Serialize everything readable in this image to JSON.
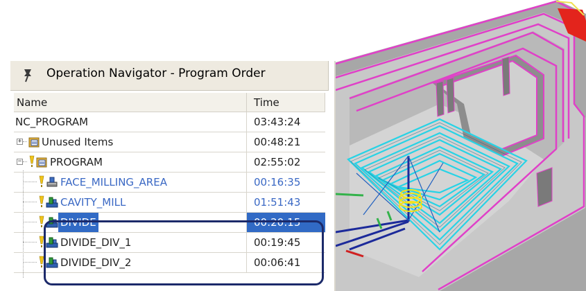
{
  "navigator": {
    "title": "Operation Navigator - Program Order",
    "pin_icon": "pin-icon",
    "columns": {
      "name": "Name",
      "time": "Time"
    },
    "rows": [
      {
        "name": "NC_PROGRAM",
        "time": "03:43:24"
      },
      {
        "name": "Unused Items",
        "time": "00:48:21",
        "icon": "program-group-icon",
        "expander": "+"
      },
      {
        "name": "PROGRAM",
        "time": "02:55:02",
        "icon": "program-group-icon",
        "expander": "−"
      },
      {
        "name": "FACE_MILLING_AREA",
        "time": "00:16:35",
        "icon": "face-milling-icon",
        "color": "#3a68c4"
      },
      {
        "name": "CAVITY_MILL",
        "time": "01:51:43",
        "icon": "cavity-mill-icon",
        "color": "#3a68c4"
      },
      {
        "name": "DIVIDE",
        "time": "00:20:15",
        "icon": "cavity-mill-icon",
        "selected": true
      },
      {
        "name": "DIVIDE_DIV_1",
        "time": "00:19:45",
        "icon": "cavity-mill-icon"
      },
      {
        "name": "DIVIDE_DIV_2",
        "time": "00:06:41",
        "icon": "cavity-mill-icon"
      }
    ]
  },
  "colors": {
    "selection": "#316ac5",
    "outline": "#1c2a6a",
    "status_yellow": "#f0c419",
    "toolpath_cyan": "#27d3e6",
    "part_magenta": "#e040c8"
  }
}
